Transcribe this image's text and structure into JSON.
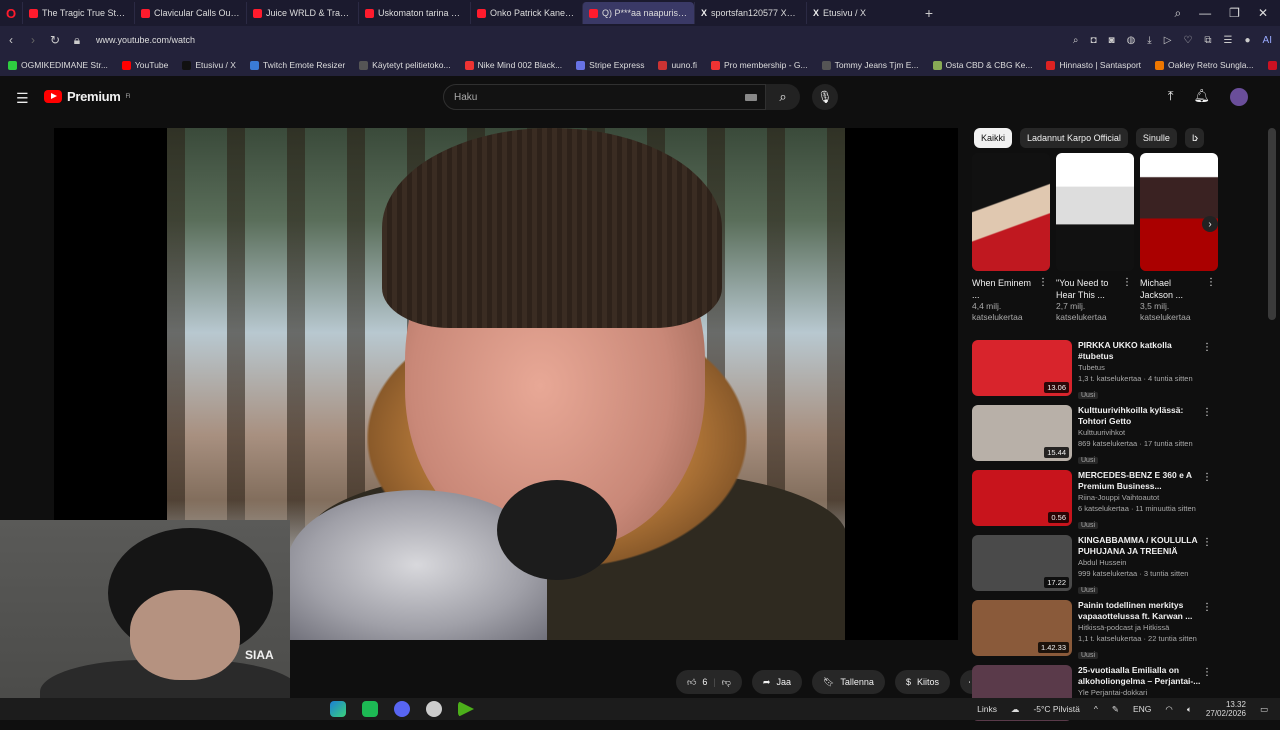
{
  "browser": {
    "tabs": [
      {
        "label": "The Tragic True Story of Ju",
        "icon": "youtube-icon"
      },
      {
        "label": "Clavicular Calls Out Larry",
        "icon": "youtube-icon"
      },
      {
        "label": "Juice WRLD & Travis Scott",
        "icon": "youtube-icon"
      },
      {
        "label": "Uskomaton tarina siinikk",
        "icon": "youtube-icon"
      },
      {
        "label": "Onko Patrick Kane kaikkin",
        "icon": "youtube-icon"
      },
      {
        "label": "Q) P***aa naapurissa | Kii",
        "icon": "youtube-icon"
      },
      {
        "label": "sportsfan120577 Xsss: \"G",
        "icon": "x-icon"
      },
      {
        "label": "Etusivu / X",
        "icon": "x-icon"
      }
    ],
    "url": "www.youtube.com/watch",
    "bookmarks": [
      {
        "label": "OGMIKEDIMANE Str..."
      },
      {
        "label": "YouTube"
      },
      {
        "label": "Etusivu / X"
      },
      {
        "label": "Twitch Emote Resizer"
      },
      {
        "label": "Käytetyt pelitietoko..."
      },
      {
        "label": "Nike Mind 002 Black..."
      },
      {
        "label": "Stripe Express"
      },
      {
        "label": "uuno.fi"
      },
      {
        "label": "Pro membership - G..."
      },
      {
        "label": "Tommy Jeans Tjm E..."
      },
      {
        "label": "Osta CBD & CBG Ke..."
      },
      {
        "label": "Hinnasto | Santasport"
      },
      {
        "label": "Oakley Retro Sungla..."
      },
      {
        "label": "TVkaista - Sub Suora"
      }
    ]
  },
  "youtube": {
    "logo": "Premium",
    "logo_sup": "FI",
    "search_placeholder": "Haku",
    "video_title": "SIAA",
    "actions": {
      "likes": "6",
      "share": "Jaa",
      "save": "Tallenna",
      "thanks": "Kiitos"
    },
    "chips": [
      "Kaikki",
      "Ladannut Karpo Official",
      "Sinulle",
      "L"
    ],
    "shorts": [
      {
        "title": "When Eminem ...",
        "views": "4,4 milj.",
        "views2": "katselukertaa"
      },
      {
        "title": "\"You Need to Hear This ...",
        "views": "2,7 milj.",
        "views2": "katselukertaa"
      },
      {
        "title": "Michael Jackson ...",
        "views": "3,5 milj.",
        "views2": "katselukertaa"
      }
    ],
    "recommendations": [
      {
        "title": "PIRKKA UKKO katkolla #tubetus",
        "channel": "Tubetus",
        "meta": "1,3 t. katselukertaa · 4 tuntia sitten",
        "badge": "Uusi",
        "duration": "13.06",
        "color": "#d8242c"
      },
      {
        "title": "Kulttuurivihkoilla kylässä: Tohtori Getto",
        "channel": "Kulttuurivihkot",
        "meta": "869 katselukertaa · 17 tuntia sitten",
        "badge": "Uusi",
        "duration": "15.44",
        "color": "#b8b0a8"
      },
      {
        "title": "MERCEDES-BENZ E 360 e A Premium Business...",
        "channel": "Riina-Jouppi Vaihtoautot",
        "meta": "6 katselukertaa · 11 minuuttia sitten",
        "badge": "Uusi",
        "duration": "0.56",
        "color": "#c8141c"
      },
      {
        "title": "KINGABBAMMA / KOULULLA PUHUJANA JA TREENIÄ",
        "channel": "Abdul Hussein",
        "meta": "999 katselukertaa · 3 tuntia sitten",
        "badge": "Uusi",
        "duration": "17.22",
        "color": "#4a4a4a"
      },
      {
        "title": "Painin todellinen merkitys vapaaottelussa ft. Karwan ...",
        "channel": "Hitkissä-podcast ja Hitkissä",
        "meta": "1,1 t. katselukertaa · 22 tuntia sitten",
        "badge": "Uusi",
        "duration": "1.42.33",
        "color": "#8a5a3a"
      },
      {
        "title": "25-vuotiaalla Emilialla on alkoholiongelma – Perjantai-...",
        "channel": "Yle Perjantai-dokkari",
        "meta": "",
        "badge": "",
        "duration": "",
        "color": "#5a3a4a"
      }
    ]
  },
  "taskbar": {
    "links": "Links",
    "weather": "-5°C  Pilvistä",
    "lang": "ENG",
    "time": "13.32",
    "date": "27/02/2026"
  }
}
